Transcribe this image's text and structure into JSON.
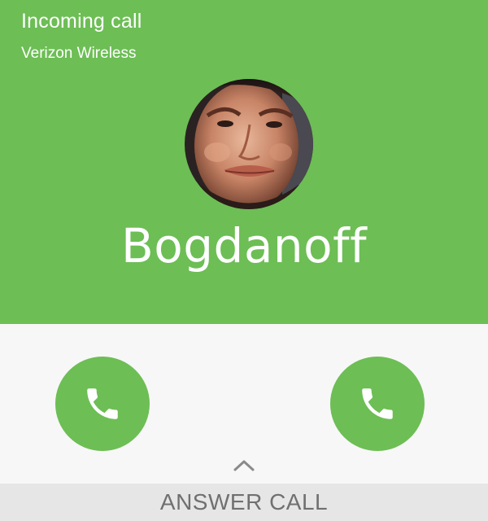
{
  "call": {
    "status": "Incoming call",
    "carrier": "Verizon Wireless",
    "caller_name": "Bogdanoff"
  },
  "actions": {
    "answer_label": "ANSWER CALL"
  },
  "icons": {
    "left_button": "phone-icon",
    "right_button": "phone-icon",
    "swipe": "chevron-up-icon"
  },
  "colors": {
    "accent_green": "#6dbe55",
    "background": "#f7f7f7",
    "answer_bar": "#e6e6e6"
  }
}
